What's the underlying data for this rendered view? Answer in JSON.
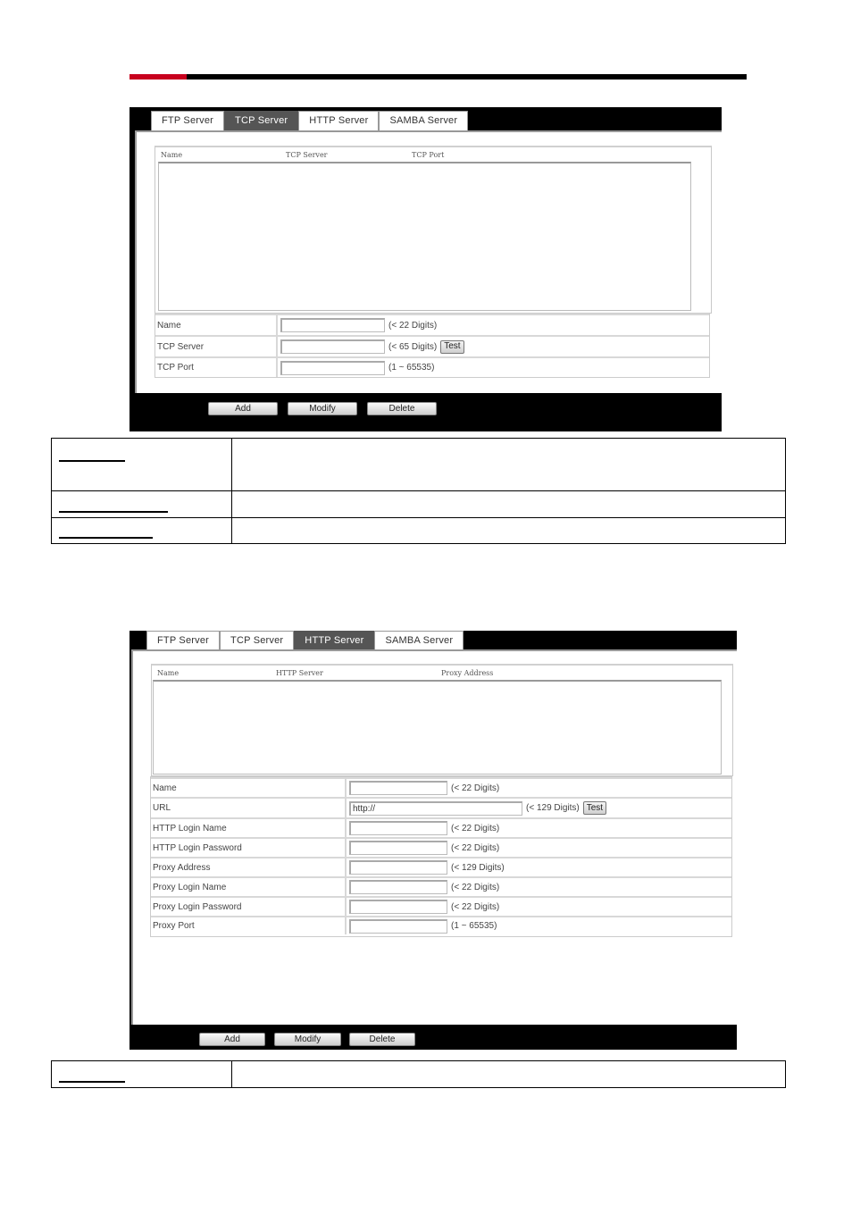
{
  "header": {
    "accent_color": "#c8001e",
    "bar_color": "#000000"
  },
  "tcp_panel": {
    "tabs": [
      {
        "label": "FTP Server",
        "active": false
      },
      {
        "label": "TCP Server",
        "active": true
      },
      {
        "label": "HTTP Server",
        "active": false
      },
      {
        "label": "SAMBA Server",
        "active": false
      }
    ],
    "list_columns": [
      "Name",
      "TCP Server",
      "TCP Port"
    ],
    "form_rows": [
      {
        "label": "Name",
        "value": "",
        "hint": "(< 22 Digits)"
      },
      {
        "label": "TCP Server",
        "value": "",
        "hint": "(< 65 Digits)",
        "button": "Test"
      },
      {
        "label": "TCP Port",
        "value": "",
        "hint": "(1 ~ 65535)"
      }
    ],
    "actions": {
      "add": "Add",
      "modify": "Modify",
      "delete": "Delete"
    }
  },
  "tcp_description_table": {
    "rows": [
      {
        "term": "",
        "description": ""
      },
      {
        "term": "",
        "description": ""
      },
      {
        "term": "",
        "description": ""
      }
    ]
  },
  "http_panel": {
    "tabs": [
      {
        "label": "FTP Server",
        "active": false
      },
      {
        "label": "TCP Server",
        "active": false
      },
      {
        "label": "HTTP Server",
        "active": true
      },
      {
        "label": "SAMBA Server",
        "active": false
      }
    ],
    "list_columns": [
      "Name",
      "HTTP Server",
      "Proxy Address"
    ],
    "form_rows": [
      {
        "label": "Name",
        "value": "",
        "hint": "(< 22 Digits)"
      },
      {
        "label": "URL",
        "value": "http://",
        "hint": "(< 129 Digits)",
        "button": "Test"
      },
      {
        "label": "HTTP Login Name",
        "value": "",
        "hint": "(< 22 Digits)"
      },
      {
        "label": "HTTP Login Password",
        "value": "",
        "hint": "(< 22 Digits)"
      },
      {
        "label": "Proxy Address",
        "value": "",
        "hint": "(< 129 Digits)"
      },
      {
        "label": "Proxy Login Name",
        "value": "",
        "hint": "(< 22 Digits)"
      },
      {
        "label": "Proxy Login Password",
        "value": "",
        "hint": "(< 22 Digits)"
      },
      {
        "label": "Proxy Port",
        "value": "",
        "hint": "(1 ~ 65535)"
      }
    ],
    "actions": {
      "add": "Add",
      "modify": "Modify",
      "delete": "Delete"
    }
  },
  "http_description_table": {
    "rows": [
      {
        "term": "",
        "description": ""
      }
    ]
  }
}
